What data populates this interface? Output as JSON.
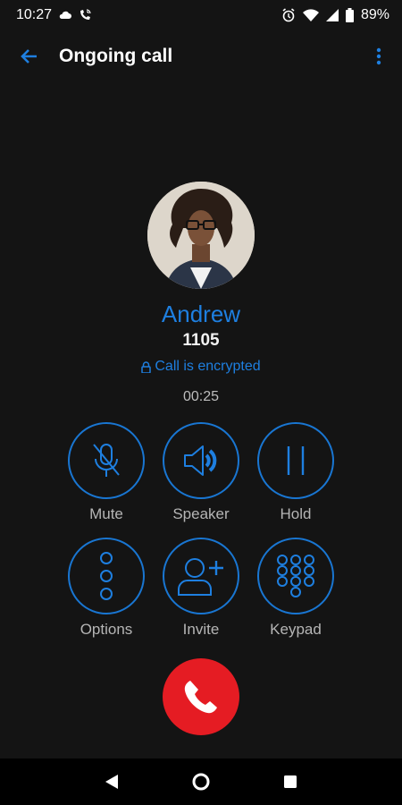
{
  "status_bar": {
    "time": "10:27",
    "battery": "89%",
    "icons": [
      "cloud-icon",
      "phone-wifi-icon",
      "alarm-icon",
      "wifi-icon",
      "signal-icon",
      "battery-icon"
    ]
  },
  "app_bar": {
    "title": "Ongoing call",
    "icons": [
      "back-arrow-icon",
      "more-vert-icon"
    ]
  },
  "caller": {
    "name": "Andrew",
    "number": "1105",
    "encryption_text": "Call is encrypted",
    "duration": "00:25"
  },
  "controls": {
    "mute": "Mute",
    "speaker": "Speaker",
    "hold": "Hold",
    "options": "Options",
    "invite": "Invite",
    "keypad": "Keypad"
  },
  "colors": {
    "accent": "#1e7fe0",
    "end_call": "#e51c23",
    "background": "#141414"
  }
}
